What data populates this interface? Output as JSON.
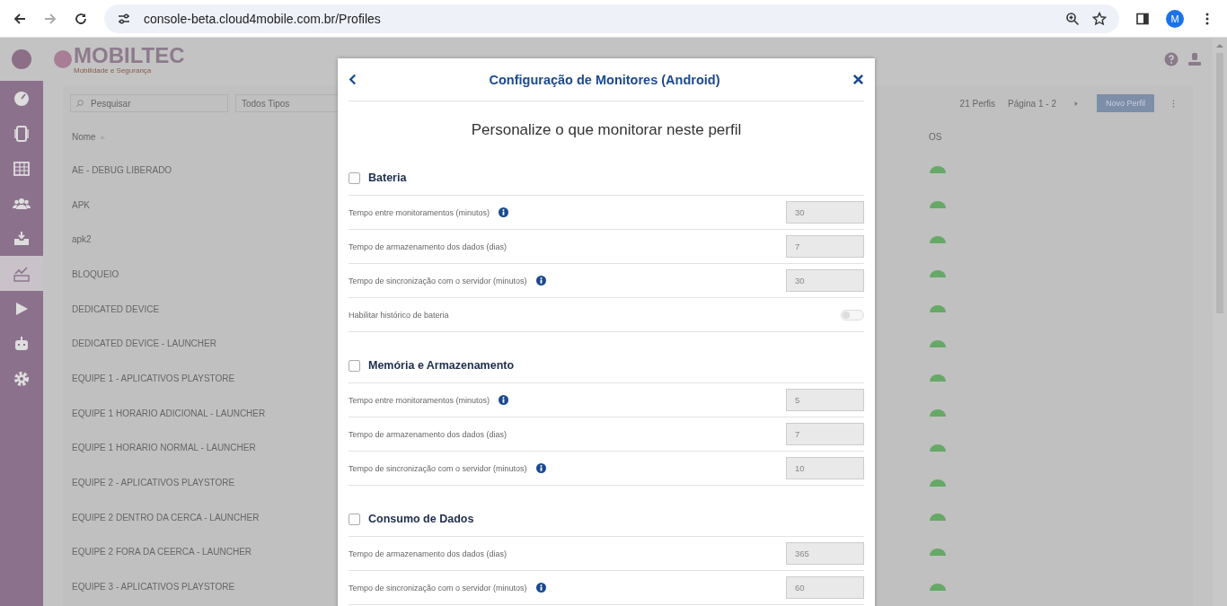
{
  "browser": {
    "url": "console-beta.cloud4mobile.com.br/Profiles",
    "avatar": "M"
  },
  "app": {
    "logo": "MOBILTEC",
    "tagline": "Mobilidade e Segurança",
    "sidebar": [
      {
        "kind": "gauge",
        "selected": false
      },
      {
        "kind": "phone",
        "selected": false
      },
      {
        "kind": "table",
        "selected": false
      },
      {
        "kind": "users",
        "selected": false
      },
      {
        "kind": "inbox",
        "selected": false
      },
      {
        "kind": "chart",
        "selected": true
      },
      {
        "kind": "play",
        "selected": false
      },
      {
        "kind": "robot",
        "selected": false
      },
      {
        "kind": "gear",
        "selected": false
      }
    ],
    "search": {
      "placeholder": "Pesquisar"
    },
    "type_filter": "Todos Tipos",
    "count": "21 Perfis",
    "pages": "Página 1 - 2",
    "new_button": "Novo Perfil",
    "columns": [
      "Nome",
      "OS"
    ],
    "rows": [
      {
        "name": "AE - DEBUG LIBERADO"
      },
      {
        "name": "APK"
      },
      {
        "name": "apk2"
      },
      {
        "name": "BLOQUEIO"
      },
      {
        "name": "DEDICATED DEVICE"
      },
      {
        "name": "DEDICATED DEVICE - LAUNCHER"
      },
      {
        "name": "EQUIPE 1 - APLICATIVOS PLAYSTORE"
      },
      {
        "name": "EQUIPE 1 HORARIO ADICIONAL - LAUNCHER"
      },
      {
        "name": "EQUIPE 1 HORARIO NORMAL - LAUNCHER"
      },
      {
        "name": "EQUIPE 2 - APLICATIVOS PLAYSTORE"
      },
      {
        "name": "EQUIPE 2 DENTRO DA CERCA - LAUNCHER"
      },
      {
        "name": "EQUIPE 2 FORA DA CEERCA - LAUNCHER"
      },
      {
        "name": "EQUIPE 3 - APLICATIVOS PLAYSTORE"
      }
    ]
  },
  "modal": {
    "title": "Configuração de Monitores (Android)",
    "subtitle": "Personalize o que monitorar neste perfil",
    "sections": [
      {
        "title": "Bateria",
        "checked": false,
        "rows": [
          {
            "kind": "field",
            "label": "Tempo entre monitoramentos (minutos)",
            "info": true,
            "value": "30"
          },
          {
            "kind": "field",
            "label": "Tempo de armazenamento dos dados (dias)",
            "info": false,
            "value": "7"
          },
          {
            "kind": "field",
            "label": "Tempo de sincronização com o servidor (minutos)",
            "info": true,
            "value": "30"
          },
          {
            "kind": "toggle",
            "label": "Habilitar histórico de bateria",
            "on": false
          }
        ]
      },
      {
        "title": "Memória e Armazenamento",
        "checked": false,
        "rows": [
          {
            "kind": "field",
            "label": "Tempo entre monitoramentos (minutos)",
            "info": true,
            "value": "5"
          },
          {
            "kind": "field",
            "label": "Tempo de armazenamento dos dados (dias)",
            "info": false,
            "value": "7"
          },
          {
            "kind": "field",
            "label": "Tempo de sincronização com o servidor (minutos)",
            "info": true,
            "value": "10"
          }
        ]
      },
      {
        "title": "Consumo de Dados",
        "checked": false,
        "rows": [
          {
            "kind": "field",
            "label": "Tempo de armazenamento dos dados (dias)",
            "info": false,
            "value": "365"
          },
          {
            "kind": "field",
            "label": "Tempo de sincronização com o servidor (minutos)",
            "info": true,
            "value": "60"
          }
        ]
      }
    ]
  }
}
